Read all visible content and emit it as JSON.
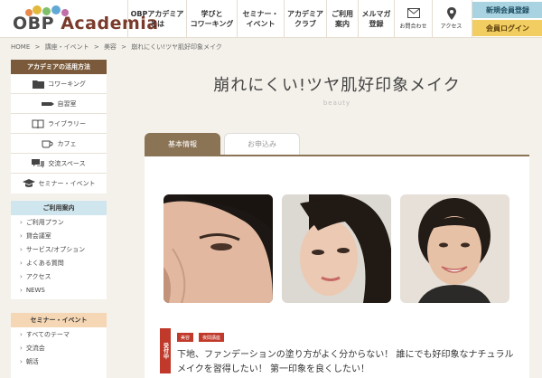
{
  "logo": {
    "text_prefix": "OBP ",
    "text_accent": "Academia"
  },
  "nav": {
    "items": [
      {
        "label": "OBPアカデミア\nとは"
      },
      {
        "label": "学びと\nコワーキング"
      },
      {
        "label": "セミナー・\nイベント"
      },
      {
        "label": "アカデミア\nクラブ"
      },
      {
        "label": "ご利用\n案内"
      },
      {
        "label": "メルマガ\n登録"
      }
    ],
    "contact_label": "お問合わせ",
    "access_label": "アクセス"
  },
  "member": {
    "new_label": "新規会員登録",
    "login_label": "会員ログイン"
  },
  "breadcrumb": [
    "HOME",
    ">",
    "講座・イベント",
    ">",
    "美容",
    ">",
    "崩れにくい!ツヤ肌好印象メイク"
  ],
  "sidebar": {
    "use": {
      "title": "アカデミアの活用方法",
      "items": [
        {
          "label": "コワーキング",
          "icon": "folder-icon"
        },
        {
          "label": "自習室",
          "icon": "pen-icon"
        },
        {
          "label": "ライブラリー",
          "icon": "book-icon"
        },
        {
          "label": "カフェ",
          "icon": "cup-icon"
        },
        {
          "label": "交流スペース",
          "icon": "chat-icon"
        },
        {
          "label": "セミナー・イベント",
          "icon": "graduation-cap-icon"
        }
      ]
    },
    "guide": {
      "title": "ご利用案内",
      "items": [
        "ご利用プラン",
        "貸会議室",
        "サービス/オプション",
        "よくある質問",
        "アクセス",
        "NEWS"
      ]
    },
    "seminar": {
      "title": "セミナー・イベント",
      "items": [
        "すべてのテーマ",
        "交流会",
        "朝活"
      ]
    }
  },
  "main": {
    "title": "崩れにくい!ツヤ肌好印象メイク",
    "subtitle": "beauty",
    "tabs": {
      "basic": "基本情報",
      "apply": "お申込み"
    },
    "ribbon": "受付中",
    "tags": [
      "美容",
      "夜間講座"
    ],
    "description": "下地、ファンデーションの塗り方がよく分からない！ 誰にでも好印象なナチュラル メイクを習得したい！ 第一印象を良くしたい！"
  },
  "colors": {
    "background": "#f4f1ea",
    "brand_brown": "#8b7355",
    "accent_red": "#c0392b",
    "member_new": "#a9d3e0",
    "member_login": "#f2cd61"
  }
}
